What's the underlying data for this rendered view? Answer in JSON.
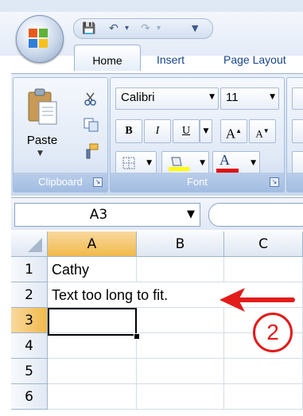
{
  "ribbon": {
    "tabs": [
      "Home",
      "Insert",
      "Page Layout"
    ],
    "clipboard": {
      "paste_label": "Paste",
      "group_label": "Clipboard"
    },
    "font": {
      "font_name": "Calibri",
      "font_size": "11",
      "bold_label": "B",
      "italic_label": "I",
      "underline_label": "U",
      "grow_label": "A",
      "shrink_label": "A",
      "font_color_label": "A",
      "group_label": "Font"
    }
  },
  "formula_bar": {
    "name_box": "A3"
  },
  "sheet": {
    "columns": [
      "A",
      "B",
      "C"
    ],
    "rows": [
      "1",
      "2",
      "3",
      "4",
      "5",
      "6"
    ],
    "cells": {
      "A1": "Cathy",
      "A2": "Text too long to fit.",
      "A3": ""
    },
    "active_cell": "A3"
  },
  "annotation": {
    "callout_number": "2"
  },
  "colors": {
    "annotation": "#e21b1b",
    "selected_header": "#f1b94a",
    "ribbon": "#c9d9ee"
  }
}
